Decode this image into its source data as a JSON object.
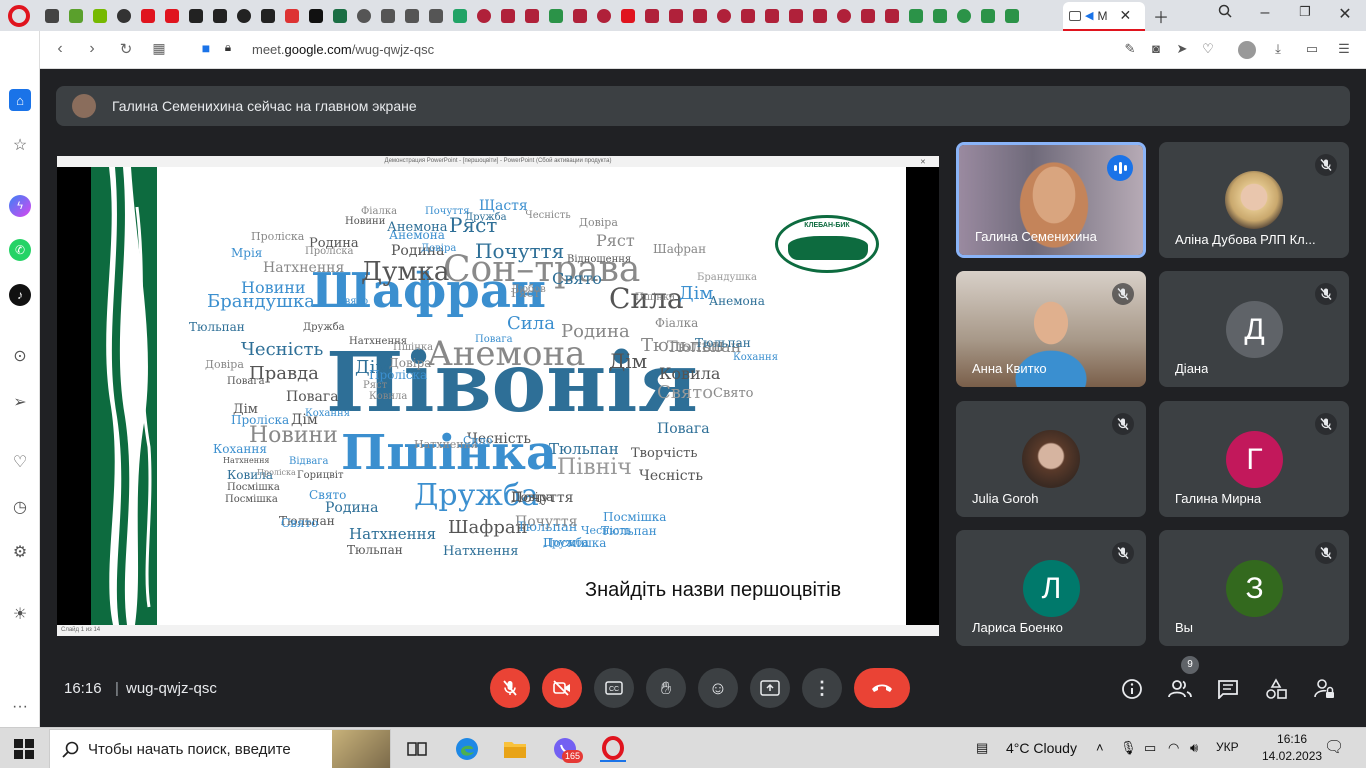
{
  "browser": {
    "tab_title": "M",
    "url_prefix": "meet.",
    "url_domain": "google.com",
    "url_path": "/wug-qwjz-qsc"
  },
  "meet": {
    "banner_text": "Галина Семенихина сейчас на главном экране",
    "meeting_time": "16:16",
    "meeting_separator": "|",
    "meeting_code": "wug-qwjz-qsc",
    "people_count": "9"
  },
  "presentation": {
    "window_title": "Демонстрация PowerPoint - [першоцвіти] - PowerPoint (Сбой активации продукта)",
    "status_text": "Слайд 1 из 14",
    "caption": "Знайдіть назви першоцвітів",
    "logo_text": "КЛЕБАН-БИК",
    "logo_subtext": "РЕГІОНАЛЬНИЙ ЛАНДШАФТНИЙ ПАРК",
    "words": [
      {
        "t": "Півонія",
        "c": "#2e6f97",
        "s": 82
      },
      {
        "t": "Шафран",
        "c": "#3b8fcf",
        "s": 48
      },
      {
        "t": "Пшінка",
        "c": "#3b8fcf",
        "s": 48
      },
      {
        "t": "Сон–трава",
        "c": "#8a8a8a",
        "s": 36
      },
      {
        "t": "Анемона",
        "c": "#888",
        "s": 34
      },
      {
        "t": "Дружба",
        "c": "#3b8fcf",
        "s": 30
      },
      {
        "t": "Думка",
        "c": "#555",
        "s": 26
      },
      {
        "t": "Сила",
        "c": "#555",
        "s": 28
      },
      {
        "t": "Почуття",
        "c": "#2e6f97",
        "s": 20
      },
      {
        "t": "Ряст",
        "c": "#2e6f97",
        "s": 20
      },
      {
        "t": "Щастя",
        "c": "#3b8fcf",
        "s": 14
      },
      {
        "t": "Чесність",
        "c": "#2e6f97",
        "s": 18
      },
      {
        "t": "Правда",
        "c": "#555",
        "s": 18
      },
      {
        "t": "Новини",
        "c": "#3b8fcf",
        "s": 16
      },
      {
        "t": "Натхнення",
        "c": "#888",
        "s": 14
      },
      {
        "t": "Брандушка",
        "c": "#3b8fcf",
        "s": 18
      },
      {
        "t": "Свято",
        "c": "#2e6f97",
        "s": 16
      },
      {
        "t": "Сила",
        "c": "#3b8fcf",
        "s": 18
      },
      {
        "t": "Родина",
        "c": "#888",
        "s": 18
      },
      {
        "t": "Тюльпан",
        "c": "#888",
        "s": 18
      },
      {
        "t": "Дім",
        "c": "#555",
        "s": 20
      },
      {
        "t": "Ковила",
        "c": "#555",
        "s": 16
      },
      {
        "t": "Свято",
        "c": "#999",
        "s": 18
      },
      {
        "t": "Повага",
        "c": "#555",
        "s": 14
      },
      {
        "t": "Новини",
        "c": "#888",
        "s": 22
      },
      {
        "t": "Чесність",
        "c": "#555",
        "s": 14
      },
      {
        "t": "Тюльпан",
        "c": "#2e6f97",
        "s": 15
      },
      {
        "t": "Творчість",
        "c": "#555",
        "s": 13
      },
      {
        "t": "Північ",
        "c": "#999",
        "s": 22
      },
      {
        "t": "Почуття",
        "c": "#555",
        "s": 14
      },
      {
        "t": "Шафран",
        "c": "#555",
        "s": 18
      },
      {
        "t": "Натхнення",
        "c": "#2e6f97",
        "s": 15
      },
      {
        "t": "Натхнення",
        "c": "#2e6f97",
        "s": 13
      },
      {
        "t": "Тюльпан",
        "c": "#3b8fcf",
        "s": 13
      },
      {
        "t": "Посмішка",
        "c": "#3b8fcf",
        "s": 12
      },
      {
        "t": "Родина",
        "c": "#2e6f97",
        "s": 14
      },
      {
        "t": "Тюльпан",
        "c": "#555",
        "s": 12
      },
      {
        "t": "Свято",
        "c": "#3b8fcf",
        "s": 12
      },
      {
        "t": "Кохання",
        "c": "#3b8fcf",
        "s": 12
      },
      {
        "t": "Посмішка",
        "c": "#555",
        "s": 10
      },
      {
        "t": "Мрія",
        "c": "#3b8fcf",
        "s": 12
      },
      {
        "t": "Тюльпан",
        "c": "#2e6f97",
        "s": 12
      },
      {
        "t": "Дім",
        "c": "#2e6f97",
        "s": 18
      },
      {
        "t": "Анемона",
        "c": "#3b8fcf",
        "s": 12
      },
      {
        "t": "Фіалка",
        "c": "#888",
        "s": 12
      },
      {
        "t": "Тюльпан",
        "c": "#888",
        "s": 16
      },
      {
        "t": "Повага",
        "c": "#2e6f97",
        "s": 14
      },
      {
        "t": "Свято",
        "c": "#888",
        "s": 13
      },
      {
        "t": "Довіра",
        "c": "#888",
        "s": 11
      },
      {
        "t": "Родина",
        "c": "#555",
        "s": 13
      },
      {
        "t": "Анемона",
        "c": "#2e6f97",
        "s": 13
      },
      {
        "t": "Пролiска",
        "c": "#888",
        "s": 11
      },
      {
        "t": "Пролiска",
        "c": "#3b8fcf",
        "s": 12
      },
      {
        "t": "Дружба",
        "c": "#3b8fcf",
        "s": 11
      },
      {
        "t": "Чесність",
        "c": "#3b8fcf",
        "s": 11
      },
      {
        "t": "Ряст",
        "c": "#888",
        "s": 16
      },
      {
        "t": "Ряст",
        "c": "#888",
        "s": 12
      },
      {
        "t": "Відношення",
        "c": "#555",
        "s": 10
      },
      {
        "t": "Фіалка",
        "c": "#888",
        "s": 10
      },
      {
        "t": "Почуття",
        "c": "#3b8fcf",
        "s": 10
      },
      {
        "t": "Чесність",
        "c": "#888",
        "s": 10
      },
      {
        "t": "Довіра",
        "c": "#888",
        "s": 11
      },
      {
        "t": "Новини",
        "c": "#555",
        "s": 10
      },
      {
        "t": "Пролiска",
        "c": "#888",
        "s": 10
      },
      {
        "t": "Родина",
        "c": "#555",
        "s": 14
      },
      {
        "t": "Довіра",
        "c": "#3b8fcf",
        "s": 10
      },
      {
        "t": "Шафран",
        "c": "#888",
        "s": 12
      },
      {
        "t": "Брандушка",
        "c": "#999",
        "s": 10
      },
      {
        "t": "Дім",
        "c": "#3b8fcf",
        "s": 18
      },
      {
        "t": "Любов",
        "c": "#888",
        "s": 10
      },
      {
        "t": "Пшінка",
        "c": "#888",
        "s": 10
      },
      {
        "t": "Анемона",
        "c": "#2e6f97",
        "s": 12
      },
      {
        "t": "Кохання",
        "c": "#3b8fcf",
        "s": 10
      },
      {
        "t": "Тюльпан",
        "c": "#2e6f97",
        "s": 12
      },
      {
        "t": "Повага",
        "c": "#3b8fcf",
        "s": 10
      },
      {
        "t": "Натхнення",
        "c": "#555",
        "s": 10
      },
      {
        "t": "Свято",
        "c": "#3b8fcf",
        "s": 10
      },
      {
        "t": "Дружба",
        "c": "#555",
        "s": 10
      },
      {
        "t": "Довіра",
        "c": "#888",
        "s": 12
      },
      {
        "t": "Пшінка",
        "c": "#888",
        "s": 10
      },
      {
        "t": "Дім",
        "c": "#555",
        "s": 13
      },
      {
        "t": "Ряст",
        "c": "#888",
        "s": 10
      },
      {
        "t": "Пролiска",
        "c": "#3b8fcf",
        "s": 12
      },
      {
        "t": "Кохання",
        "c": "#3b8fcf",
        "s": 10
      },
      {
        "t": "Повага",
        "c": "#555",
        "s": 10
      },
      {
        "t": "Ковила",
        "c": "#888",
        "s": 10
      },
      {
        "t": "Дім",
        "c": "#555",
        "s": 14
      },
      {
        "t": "Натхнення",
        "c": "#555",
        "s": 8
      },
      {
        "t": "Ковила",
        "c": "#2e6f97",
        "s": 12
      },
      {
        "t": "Посмішка",
        "c": "#555",
        "s": 10
      },
      {
        "t": "Пролiска",
        "c": "#888",
        "s": 8
      },
      {
        "t": "Відвага",
        "c": "#3b8fcf",
        "s": 10
      },
      {
        "t": "Горицвіт",
        "c": "#555",
        "s": 10
      },
      {
        "t": "Свято",
        "c": "#3b8fcf",
        "s": 12
      },
      {
        "t": "Тюльпан",
        "c": "#555",
        "s": 12
      },
      {
        "t": "Натхнення",
        "c": "#888",
        "s": 11
      },
      {
        "t": "Сило",
        "c": "#3b8fcf",
        "s": 11
      },
      {
        "t": "Чесність",
        "c": "#555",
        "s": 14
      },
      {
        "t": "Довіра",
        "c": "#555",
        "s": 12
      },
      {
        "t": "Почуття",
        "c": "#888",
        "s": 14
      },
      {
        "t": "Тюльпан",
        "c": "#3b8fcf",
        "s": 12
      },
      {
        "t": "Посмішка",
        "c": "#3b8fcf",
        "s": 12
      },
      {
        "t": "Дружба",
        "c": "#2e6f97",
        "s": 10
      }
    ]
  },
  "participants": [
    {
      "name": "Галина Семенихина",
      "type": "video",
      "muted": false,
      "speaking": true
    },
    {
      "name": "Аліна Дубова РЛП Кл...",
      "type": "photo",
      "muted": true
    },
    {
      "name": "Анна Квитко",
      "type": "video",
      "muted": true
    },
    {
      "name": "Діана",
      "type": "letter",
      "letter": "Д",
      "color": "#5f6368",
      "muted": true
    },
    {
      "name": "Julia Goroh",
      "type": "photo",
      "muted": true
    },
    {
      "name": "Галина Мирна",
      "type": "letter",
      "letter": "Г",
      "color": "#c2185b",
      "muted": true
    },
    {
      "name": "Лариса Боенко",
      "type": "letter",
      "letter": "Л",
      "color": "#00796b",
      "muted": true
    },
    {
      "name": "Вы",
      "type": "letter",
      "letter": "З",
      "color": "#33691e",
      "muted": true
    }
  ],
  "taskbar": {
    "search_placeholder": "Чтобы начать поиск, введите",
    "weather": "4°C  Cloudy",
    "language": "УКР",
    "time": "16:16",
    "date": "14.02.2023",
    "viber_badge": "165"
  },
  "colors": {
    "accent": "#8ab4f8",
    "end_call": "#ea4335",
    "bg": "#202124",
    "tile": "#3c4043"
  }
}
